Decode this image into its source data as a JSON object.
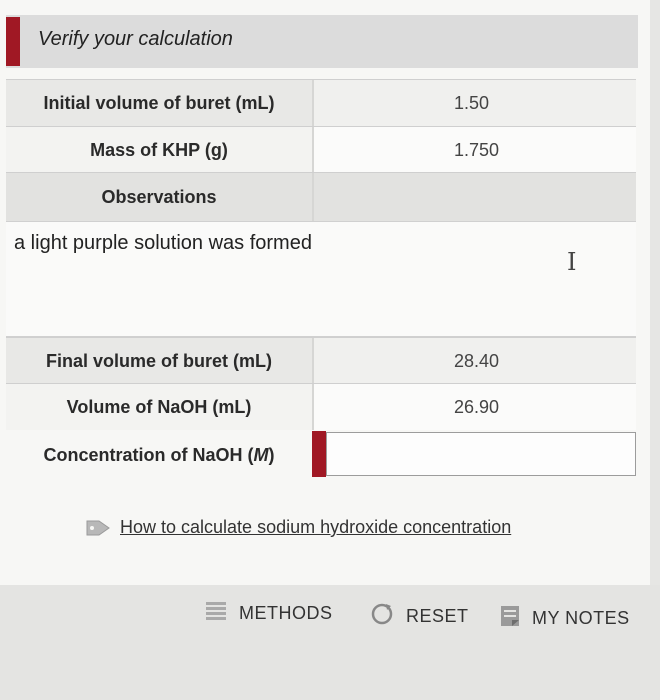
{
  "banner": {
    "title": "Verify your calculation"
  },
  "rows": [
    {
      "label": "Initial volume of buret (mL)",
      "value": "1.50"
    },
    {
      "label": "Mass of KHP (g)",
      "value": "1.750"
    }
  ],
  "observations": {
    "label": "Observations",
    "text": "a light purple solution was formed",
    "cursor_icon": "text-cursor-icon"
  },
  "rows2": [
    {
      "label": "Final volume of buret (mL)",
      "value": "28.40"
    },
    {
      "label": "Volume of NaOH (mL)",
      "value": "26.90"
    }
  ],
  "concentration": {
    "label_prefix": "Concentration of NaOH (",
    "label_unit": "M",
    "label_suffix": ")",
    "value": ""
  },
  "help": {
    "icon": "tag-icon",
    "link_text": "How to calculate sodium hydroxide concentration"
  },
  "footer": {
    "methods_label": "METHODS",
    "reset_label": "RESET",
    "notes_label": "MY NOTES"
  },
  "colors": {
    "accent": "#a01824",
    "background": "#e6e6e4"
  }
}
